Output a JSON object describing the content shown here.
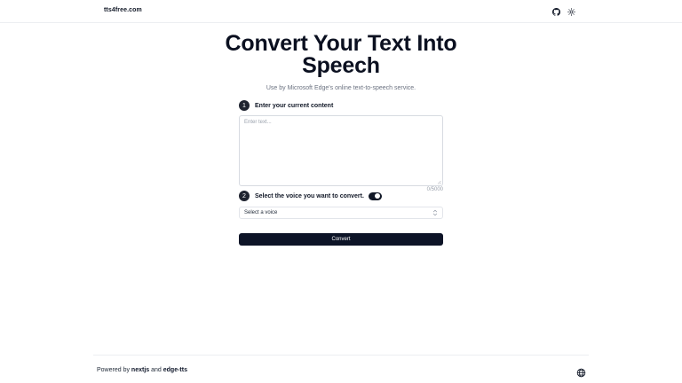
{
  "header": {
    "brand": "tts4free.com",
    "icons": [
      "github-icon",
      "sun-icon"
    ]
  },
  "hero": {
    "title_line1": "Convert Your Text Into",
    "title_line2": "Speech",
    "subtitle": "Use by Microsoft Edge's online text-to-speech service."
  },
  "step1": {
    "number": "1",
    "label": "Enter your current content",
    "placeholder": "Enter text...",
    "value": "",
    "char_count": "0/5000"
  },
  "step2": {
    "number": "2",
    "label": "Select the voice you want to convert.",
    "toggle_on": true,
    "select_value": "Select a voice"
  },
  "convert": {
    "label": "Convert"
  },
  "footer": {
    "prefix": "Powered by",
    "link1": "nextjs",
    "conj": "and",
    "link2": "edge-tts",
    "icon": "globe-icon"
  },
  "colors": {
    "primary": "#0d1427",
    "muted_text": "#6b7280",
    "border": "#d7dbe1"
  }
}
